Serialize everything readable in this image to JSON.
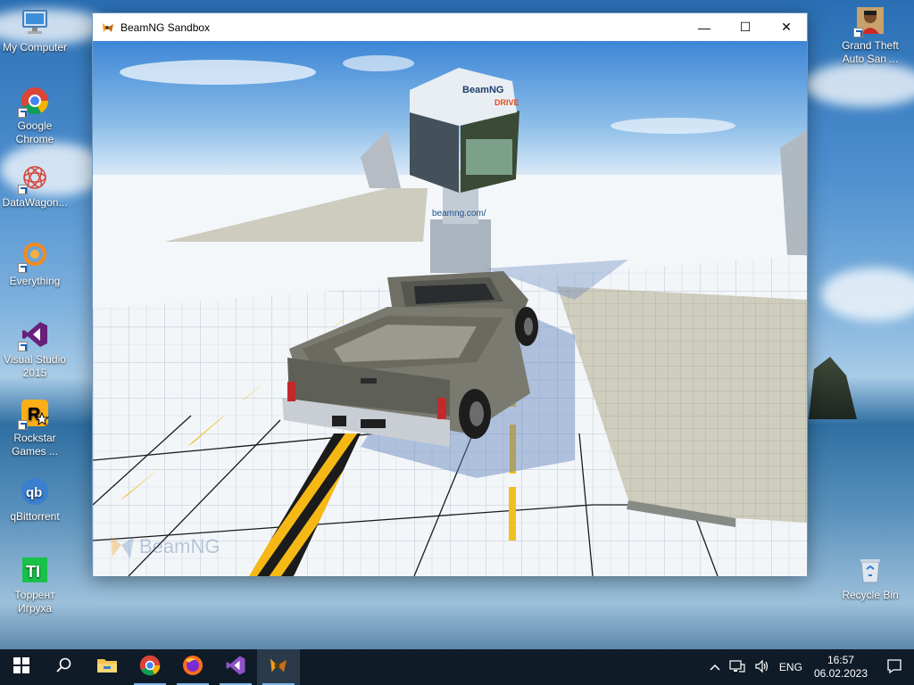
{
  "desktop": {
    "left_icons": [
      {
        "label": "My Computer",
        "icon": "computer-icon"
      },
      {
        "label": "Google Chrome",
        "icon": "chrome-icon"
      },
      {
        "label": "DataWagon...",
        "icon": "datawagon-icon"
      },
      {
        "label": "Everything",
        "icon": "everything-icon"
      },
      {
        "label": "Visual Studio 2015",
        "icon": "visual-studio-icon"
      },
      {
        "label": "Rockstar Games ...",
        "icon": "rockstar-icon"
      },
      {
        "label": "qBittorrent",
        "icon": "qbittorrent-icon"
      },
      {
        "label": "Торрент Игруха",
        "icon": "torrent-igruha-icon"
      }
    ],
    "right_icons": [
      {
        "label": "Grand Theft Auto San ...",
        "icon": "gta-icon"
      },
      {
        "label": "Recycle Bin",
        "icon": "recycle-bin-icon"
      }
    ]
  },
  "window": {
    "title": "BeamNG Sandbox",
    "minimize": "—",
    "maximize": "☐",
    "close": "✕",
    "scene": {
      "billboard_brand": "BeamNG",
      "billboard_suffix": "DRIVE",
      "pillar_text": "beamng.com/",
      "watermark": "BeamNG"
    }
  },
  "taskbar": {
    "apps": [
      {
        "name": "start-button",
        "icon": "windows-icon"
      },
      {
        "name": "search-button",
        "icon": "search-icon"
      },
      {
        "name": "taskbar-file-explorer",
        "icon": "folder-icon"
      },
      {
        "name": "taskbar-chrome",
        "icon": "chrome-icon"
      },
      {
        "name": "taskbar-firefox",
        "icon": "firefox-icon"
      },
      {
        "name": "taskbar-visual-studio",
        "icon": "visual-studio-icon"
      },
      {
        "name": "taskbar-beamng",
        "icon": "beamng-icon"
      }
    ],
    "tray": {
      "language": "ENG",
      "time": "16:57",
      "date": "06.02.2023"
    }
  },
  "colors": {
    "taskbar_bg": "#0f1b27",
    "window_border": "#6e9bc6",
    "accent": "#7fb6e8",
    "beamng_orange": "#f29b1d"
  }
}
